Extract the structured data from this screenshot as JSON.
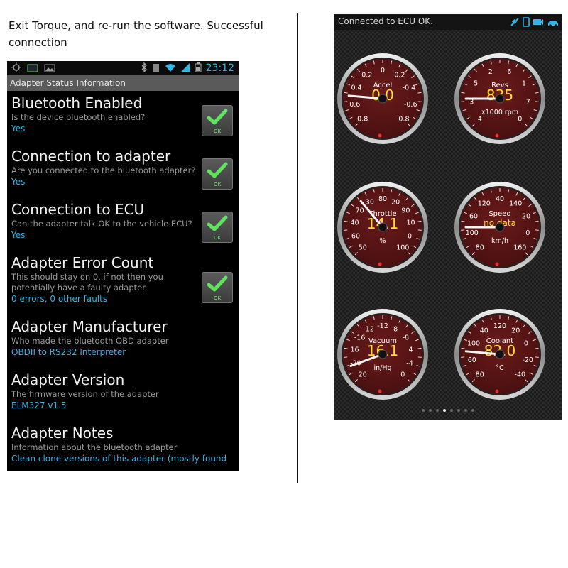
{
  "caption": "Exit Torque, and re-run the software. Successful connection",
  "left_screen": {
    "status_time": "23:12",
    "title": "Adapter Status Information",
    "items": [
      {
        "title": "Bluetooth Enabled",
        "desc": "Is the device bluetooth enabled?",
        "value": "Yes",
        "ok": "OK"
      },
      {
        "title": "Connection to adapter",
        "desc": "Are you connected to the bluetooth adapter?",
        "value": "Yes",
        "ok": "OK"
      },
      {
        "title": "Connection to ECU",
        "desc": "Can the adapter talk OK to the vehicle ECU?",
        "value": "Yes",
        "ok": "OK"
      },
      {
        "title": "Adapter Error Count",
        "desc": "This should stay on 0, if not then you potentially have a faulty adapter.",
        "value": "0 errors, 0 other faults",
        "ok": "OK"
      },
      {
        "title": "Adapter Manufacturer",
        "desc": "Who made the bluetooth OBD adapter",
        "value": "OBDII to RS232 Interpreter"
      },
      {
        "title": "Adapter Version",
        "desc": "The firmware version of the adapter",
        "value": "ELM327 v1.5"
      },
      {
        "title": "Adapter Notes",
        "desc": "Information about the bluetooth adapter",
        "value": "Clean clone versions of this adapter (mostly found"
      }
    ]
  },
  "right_screen": {
    "status": "Connected to ECU OK.",
    "gauges": [
      {
        "name": "Accel",
        "value": "0.0",
        "unit": "",
        "ticks": [
          "0.8",
          "0.6",
          "0.4",
          "0.2",
          "0",
          "-0.2",
          "-0.4",
          "-0.6",
          "-0.8"
        ]
      },
      {
        "name": "Revs",
        "value": "835",
        "unit": "x1000 rpm",
        "ticks": [
          "4",
          "3",
          "5",
          "2",
          "6",
          "1",
          "7",
          "0"
        ]
      },
      {
        "name": "Throttle",
        "value": "14.1",
        "unit": "%",
        "ticks": [
          "50",
          "60",
          "40",
          "70",
          "30",
          "80",
          "20",
          "90",
          "10",
          "0",
          "100"
        ]
      },
      {
        "name": "Speed",
        "value": "no data",
        "unit": "km/h",
        "ticks": [
          "80",
          "100",
          "60",
          "120",
          "40",
          "140",
          "20",
          "0",
          "160"
        ]
      },
      {
        "name": "Vacuum",
        "value": "16.1",
        "unit": "in/Hg",
        "ticks": [
          "20",
          "-20",
          "16",
          "-16",
          "12",
          "-12",
          "8",
          "-8",
          "4",
          "-4",
          "0"
        ]
      },
      {
        "name": "Coolant",
        "value": "82.0",
        "unit": "°C",
        "ticks": [
          "80",
          "60",
          "100",
          "40",
          "120",
          "20",
          "0",
          "-20",
          "-40"
        ]
      }
    ],
    "page_indicator": {
      "count": 8,
      "active": 4
    }
  },
  "colors": {
    "accent": "#33b5e5",
    "gauge_value": "#ffdd33",
    "ok_green": "#7de37d",
    "gauge_face": "#4a1010"
  }
}
